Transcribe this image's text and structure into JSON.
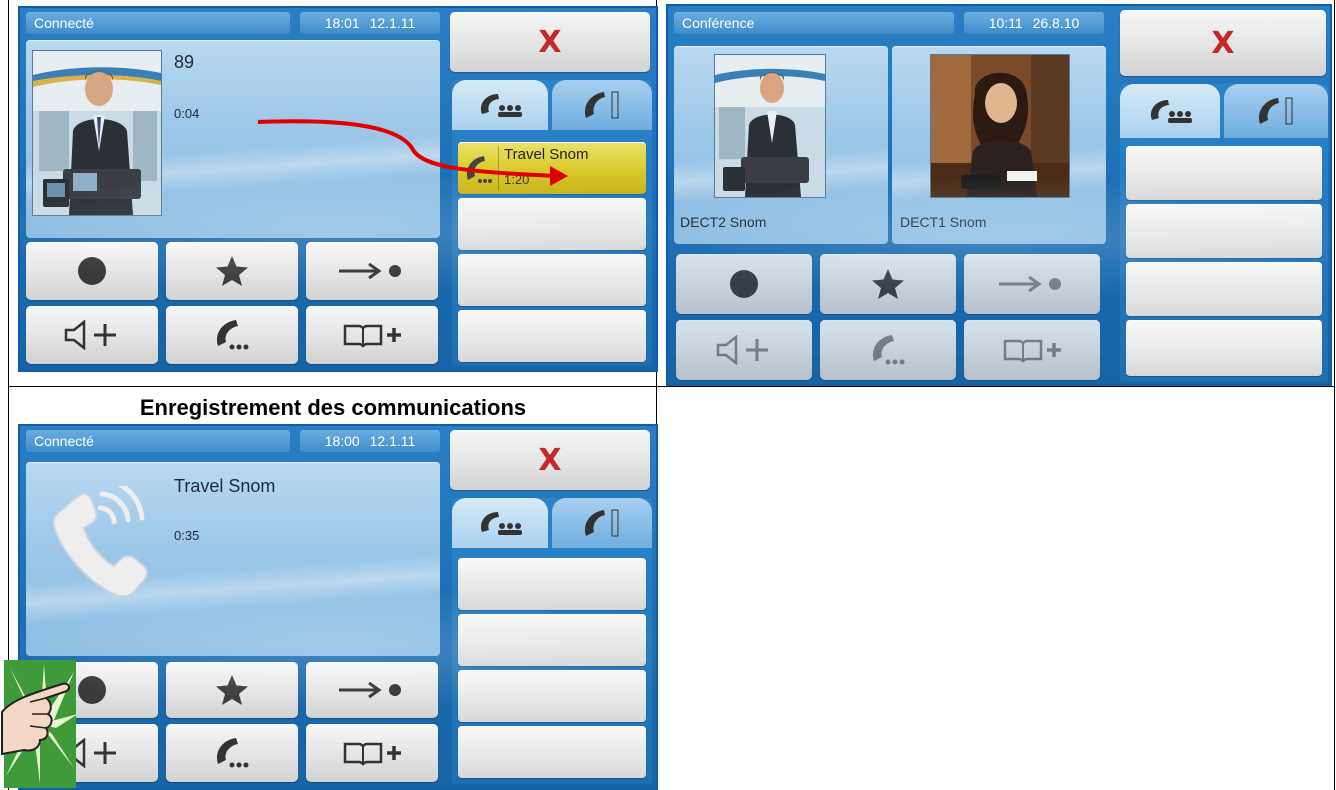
{
  "caption": "Enregistrement des communications",
  "screens": {
    "top_left": {
      "status": "Connecté",
      "clock": "18:01  12.1.11",
      "call_name": "89",
      "call_time": "0:04",
      "close_label": "X",
      "held_call": {
        "name": "Travel Snom",
        "time": "1:20"
      }
    },
    "top_right": {
      "status": "Conférence",
      "clock": "10:11  26.8.10",
      "close_label": "X",
      "participants": [
        {
          "name": "DECT2 Snom"
        },
        {
          "name": "DECT1 Snom"
        }
      ]
    },
    "bottom_left": {
      "status": "Connecté",
      "clock": "18:00  12.1.11",
      "call_name": "Travel Snom",
      "call_time": "0:35",
      "close_label": "X"
    }
  },
  "icons": {
    "record": "record-icon",
    "favorite": "star-icon",
    "transfer": "transfer-icon",
    "volume_up": "volume-up-icon",
    "calls": "call-list-icon",
    "phonebook_add": "phonebook-add-icon",
    "conference_tab": "conference-tab-icon",
    "dialpad_tab": "dialpad-tab-icon",
    "pointer": "pointing-hand-icon",
    "arrow": "transfer-arrow-icon"
  },
  "colors": {
    "screen_blue": "#1b6db3",
    "panel_blue": "#9cc7e8",
    "button_grey": "#e4e4e4",
    "close_red": "#c62828",
    "held_yellow": "#d9c92a",
    "arrow_red": "#e00000"
  }
}
